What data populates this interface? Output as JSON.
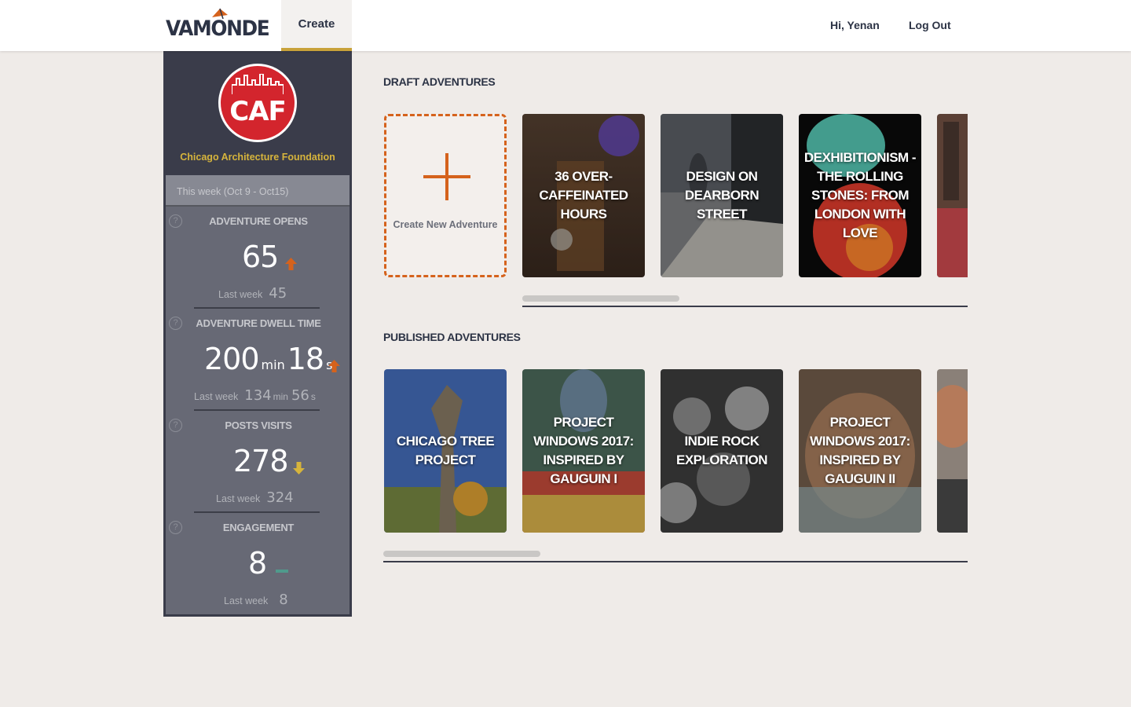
{
  "header": {
    "logo_text": "VAMONDE",
    "nav_create": "Create",
    "greeting": "Hi, Yenan",
    "logout": "Log Out"
  },
  "sidebar": {
    "org_logo_text": "CAF",
    "org_name": "Chicago Architecture Foundation",
    "week_range": "This week (Oct 9 - Oct15)",
    "help_glyph": "?",
    "stats": [
      {
        "label": "ADVENTURE OPENS",
        "value": "65",
        "trend": "up",
        "trend_color": "#d5621c",
        "last_week_label": "Last week",
        "last_week_value": "45"
      },
      {
        "label": "ADVENTURE DWELL TIME",
        "value_min": "200",
        "unit_min": "min",
        "value_sec": "18",
        "unit_sec": "s",
        "trend": "up",
        "trend_color": "#d5621c",
        "last_week_label": "Last week",
        "last_week_min": "134",
        "last_week_unit_min": "min",
        "last_week_sec": "56",
        "last_week_unit_sec": "s"
      },
      {
        "label": "POSTS VISITS",
        "value": "278",
        "trend": "down",
        "trend_color": "#d6b43c",
        "last_week_label": "Last week",
        "last_week_value": "324"
      },
      {
        "label": "ENGAGEMENT",
        "value": "8",
        "trend": "flat",
        "trend_color": "#4f9a8c",
        "last_week_label": "Last week",
        "last_week_value": "8"
      }
    ]
  },
  "draft": {
    "section_title": "DRAFT ADVENTURES",
    "create_label": "Create New Adventure",
    "cards": [
      {
        "title": "36 OVER-CAFFEINATED HOURS"
      },
      {
        "title": "DESIGN ON DEARBORN STREET"
      },
      {
        "title": "DEXHIBITIONISM - THE ROLLING STONES: FROM LONDON WITH LOVE"
      },
      {
        "title": ""
      }
    ]
  },
  "published": {
    "section_title": "PUBLISHED ADVENTURES",
    "cards": [
      {
        "title": "CHICAGO TREE PROJECT"
      },
      {
        "title": "PROJECT WINDOWS 2017: INSPIRED BY GAUGUIN I"
      },
      {
        "title": "INDIE ROCK EXPLORATION"
      },
      {
        "title": "PROJECT WINDOWS 2017: INSPIRED BY GAUGUIN II"
      },
      {
        "title": ""
      }
    ]
  },
  "colors": {
    "accent_orange": "#d5621c",
    "accent_gold": "#d6b43c",
    "navy": "#2c3345",
    "sidebar_bg": "#3a3c4a"
  }
}
